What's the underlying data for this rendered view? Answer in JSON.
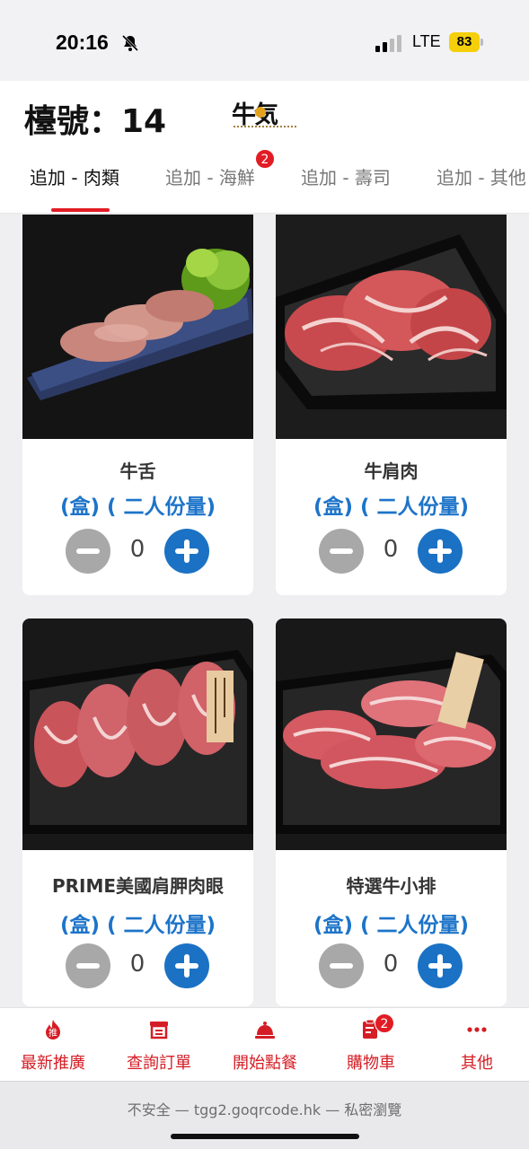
{
  "status_bar": {
    "time": "20:16",
    "network": "LTE",
    "battery": "83"
  },
  "header": {
    "table_label": "檯號：14",
    "logo_text": "牛気"
  },
  "tabs": [
    {
      "label": "追加 - 肉類",
      "active": true
    },
    {
      "label": "追加 - 海鮮",
      "badge": "2"
    },
    {
      "label": "追加 - 壽司"
    },
    {
      "label": "追加 - 其他"
    }
  ],
  "products": [
    {
      "name": "牛舌",
      "unit": "(盒) ( 二人份量)",
      "qty": "0"
    },
    {
      "name": "牛肩肉",
      "unit": "(盒) ( 二人份量)",
      "qty": "0"
    },
    {
      "name": "PRIME美國肩胛肉眼",
      "unit": "(盒) ( 二人份量)",
      "qty": "0"
    },
    {
      "name": "特選牛小排",
      "unit": "(盒) ( 二人份量)",
      "qty": "0"
    }
  ],
  "bottom_nav": [
    {
      "label": "最新推廣",
      "icon": "fire-icon",
      "icon_text": "推"
    },
    {
      "label": "查詢訂單",
      "icon": "receipt-icon"
    },
    {
      "label": "開始點餐",
      "icon": "cloche-icon"
    },
    {
      "label": "購物車",
      "icon": "clipboard-check-icon",
      "badge": "2"
    },
    {
      "label": "其他",
      "icon": "more-dots-icon"
    }
  ],
  "browser": {
    "url_line": "不安全 — tgg2.goqrcode.hk — 私密瀏覽"
  },
  "colors": {
    "accent_red": "#e11c24",
    "plus_blue": "#1b72c4",
    "unit_blue": "#1d74c9",
    "minus_gray": "#a8a8a8"
  }
}
